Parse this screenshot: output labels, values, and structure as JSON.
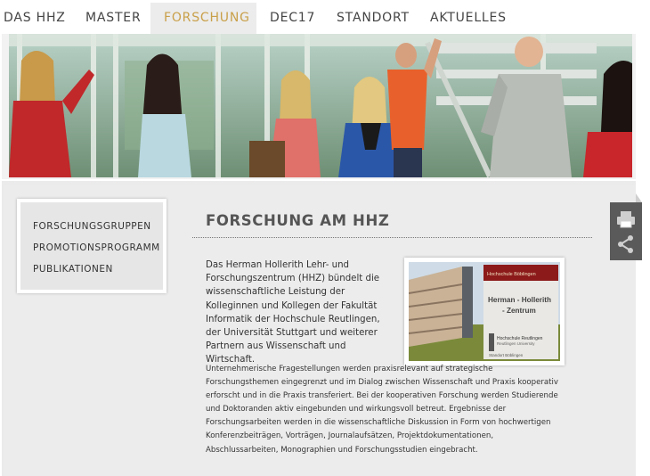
{
  "nav": {
    "items": [
      {
        "label": "DAS HHZ"
      },
      {
        "label": "MASTER"
      },
      {
        "label": "FORSCHUNG"
      },
      {
        "label": "DEC17"
      },
      {
        "label": "STANDORT"
      },
      {
        "label": "AKTUELLES"
      }
    ],
    "active": "FORSCHUNG",
    "active_color": "#c9a04a"
  },
  "sidebar": {
    "links": [
      {
        "label": "FORSCHUNGSGRUPPEN"
      },
      {
        "label": "PROMOTIONSPROGRAMM"
      },
      {
        "label": "PUBLIKATIONEN"
      }
    ]
  },
  "main": {
    "title": "FORSCHUNG AM HHZ",
    "intro": "Das Herman Hollerith Lehr- und Forschungszentrum (HHZ) bündelt die wissenschaftliche Leistung der Kolleginnen und Kollegen der Fakultät Informatik der Hochschule Reutlingen, der Universität Stuttgart und weiterer Partnern aus Wissenschaft und Wirtschaft.",
    "body": "Unternehmerische Fragestellungen werden praxisrelevant auf strategische Forschungsthemen eingegrenzt und im Dialog zwischen Wissenschaft und Praxis kooperativ erforscht und in die Praxis transferiert. Bei der kooperativen Forschung werden Studierende und Doktoranden aktiv eingebunden und wirkungsvoll betreut. Ergebnisse der Forschungsarbeiten werden in die wissenschaftliche Diskussion in Form von hochwertigen Konferenzbeiträgen, Vorträgen, Journalaufsätzen, Projektdokumentationen, Abschlussarbeiten, Monographien und Forschungsstudien eingebracht."
  },
  "photo": {
    "sign_title": "Herman - Hollerith - Zentrum",
    "sign_sub": "Hochschule Reutlingen",
    "sign_sub2": "Reutlingen University",
    "sign_top": "Hochschule Böblingen",
    "sign_bottom": "Standort Böblingen"
  },
  "tools": {
    "print_icon": "printer-icon",
    "share_icon": "share-icon"
  }
}
